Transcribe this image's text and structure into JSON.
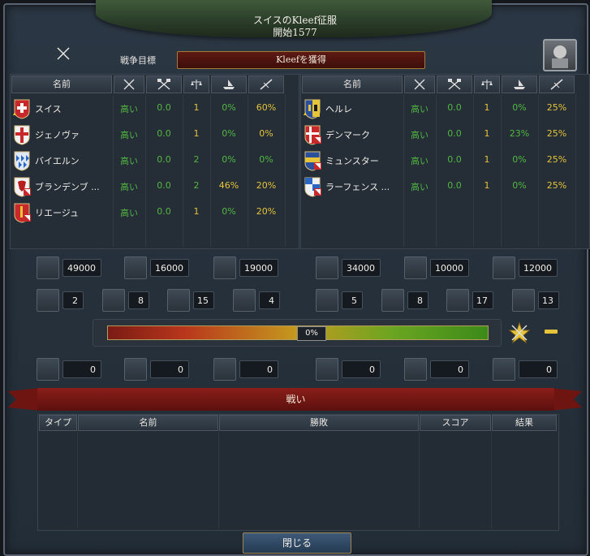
{
  "window": {
    "title": "スイスのKleef征服",
    "subtitle": "開始1577",
    "war_goal_label": "戦争目標",
    "war_goal": "Kleefを獲得"
  },
  "table_headers": {
    "name": "名前"
  },
  "icons": {
    "war_icon": "crossed-swords-icon",
    "columns": [
      "crossed-swords-icon",
      "crossed-axes-icon",
      "scales-icon",
      "ships-icon",
      "musket-icon"
    ],
    "portrait": "ruler-portrait-icon"
  },
  "attackers": [
    {
      "name": "スイス",
      "leader": true,
      "col1": "高い",
      "col2": "0.0",
      "col3": "1",
      "col4": "0%",
      "col5": "60%"
    },
    {
      "name": "ジェノヴァ",
      "col1": "高い",
      "col2": "0.0",
      "col3": "1",
      "col4": "0%",
      "col5": "0%"
    },
    {
      "name": "バイエルン",
      "col1": "高い",
      "col2": "0.0",
      "col3": "2",
      "col4": "0%",
      "col5": "0%"
    },
    {
      "name": "ブランデンブ ...",
      "col1": "高い",
      "col2": "0.0",
      "col3": "2",
      "col4": "46%",
      "col5": "20%"
    },
    {
      "name": "リエージュ",
      "col1": "高い",
      "col2": "0.0",
      "col3": "1",
      "col4": "0%",
      "col5": "20%"
    }
  ],
  "defenders": [
    {
      "name": "ヘルレ",
      "col1": "高い",
      "col2": "0.0",
      "col3": "1",
      "col4": "0%",
      "col5": "25%"
    },
    {
      "name": "デンマーク",
      "col1": "高い",
      "col2": "0.0",
      "col3": "1",
      "col4": "23%",
      "col5": "25%"
    },
    {
      "name": "ミュンスター",
      "col1": "高い",
      "col2": "0.0",
      "col3": "1",
      "col4": "0%",
      "col5": "25%"
    },
    {
      "name": "ラーフェンス ...",
      "col1": "高い",
      "col2": "0.0",
      "col3": "1",
      "col4": "0%",
      "col5": "25%"
    }
  ],
  "attacker_forces": {
    "infantry": "49000",
    "cavalry": "16000",
    "artillery": "19000",
    "heavy_ships": "2",
    "light_ships": "8",
    "galleys": "15",
    "transports": "4"
  },
  "defender_forces": {
    "infantry": "34000",
    "cavalry": "10000",
    "artillery": "12000",
    "heavy_ships": "5",
    "light_ships": "8",
    "galleys": "17",
    "transports": "13"
  },
  "war_score": {
    "label": "0%",
    "value_percent": 0
  },
  "attacker_losses": {
    "land": "0",
    "attrition": "0",
    "naval": "0"
  },
  "defender_losses": {
    "land": "0",
    "attrition": "0",
    "naval": "0"
  },
  "battles": {
    "title": "戦い",
    "headers": [
      "タイプ",
      "名前",
      "勝敗",
      "スコア",
      "結果"
    ],
    "rows": []
  },
  "close_label": "閉じる",
  "colors": {
    "good": "#52b742",
    "warning": "#e6c43a",
    "banner_red": "#8a1e1a"
  }
}
